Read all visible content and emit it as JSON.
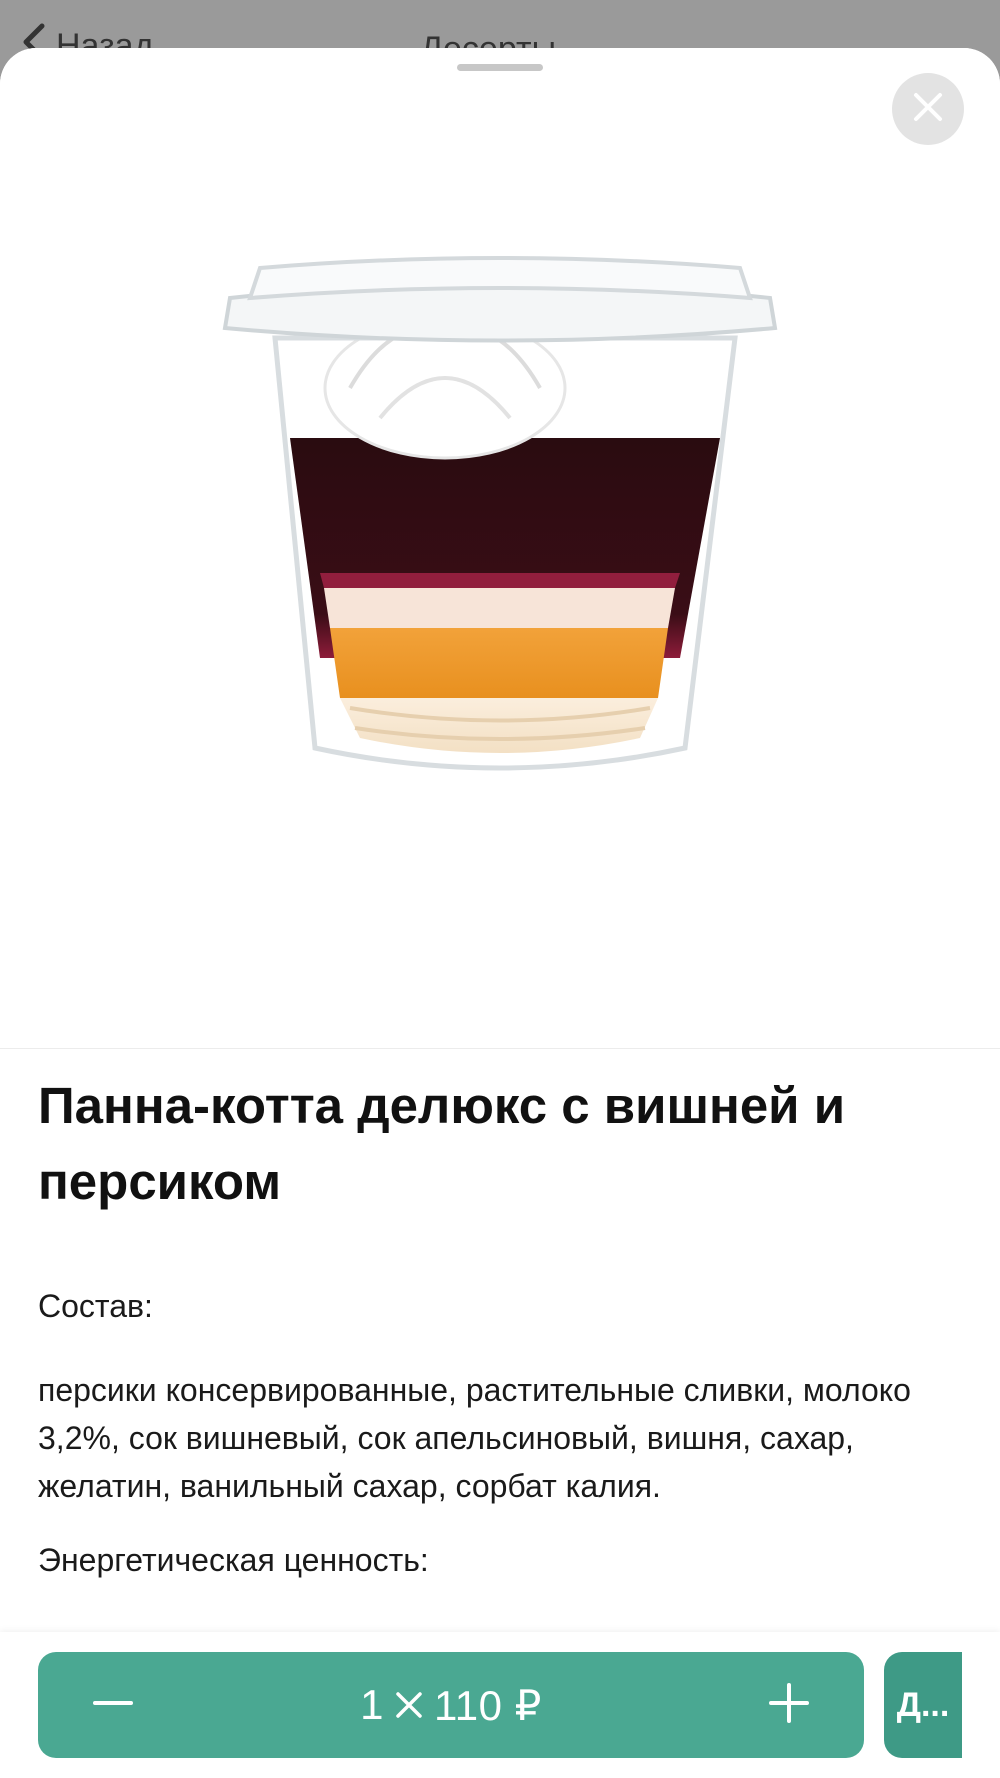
{
  "backdrop": {
    "back_label": "Назад",
    "title": "Десерты"
  },
  "product": {
    "title": "Панна-котта делюкс с вишней и персиком",
    "composition_label": "Состав:",
    "composition": "персики консервированные, растительные сливки, молоко 3,2%, сок вишневый, сок апельсиновый, вишня, сахар, желатин, ванильный сахар, сорбат калия.",
    "energy_label": "Энергетическая ценность:"
  },
  "cart": {
    "quantity": "1",
    "price": "110 ₽",
    "add_label": "Д..."
  },
  "colors": {
    "accent": "#4aa892",
    "accent_dark": "#3e9a86",
    "close_bg": "#e3e3e3"
  },
  "icons": [
    "chevron-left-icon",
    "close-icon",
    "minus-icon",
    "times-icon",
    "plus-icon"
  ]
}
